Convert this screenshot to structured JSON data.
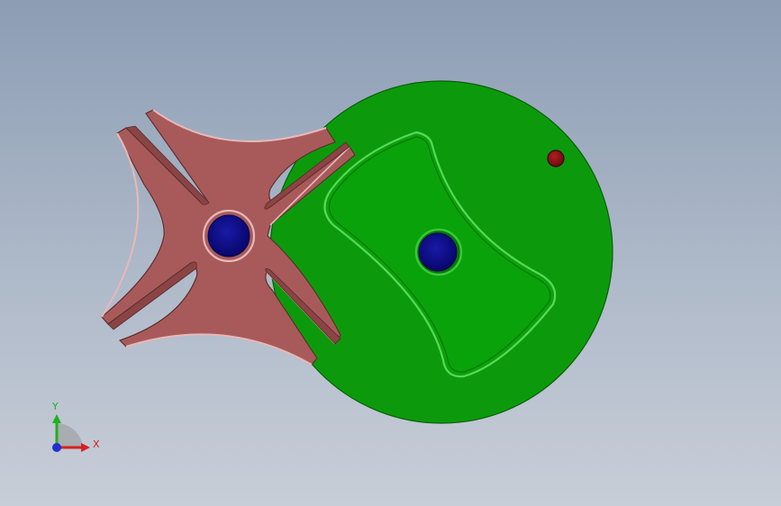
{
  "viewport": {
    "background_top": "#8c9db4",
    "background_bottom": "#c8ced8"
  },
  "model": {
    "parts": [
      {
        "name": "geneva-wheel",
        "color": "#a85a5a"
      },
      {
        "name": "drive-disc",
        "color": "#0c9a0c"
      },
      {
        "name": "shaft-hole",
        "color": "#0a0a88"
      },
      {
        "name": "drive-pin",
        "color": "#8a0e14"
      }
    ]
  },
  "triad": {
    "x_label": "X",
    "y_label": "Y",
    "x_color": "#d42020",
    "y_color": "#20b020",
    "z_color": "#2030d0"
  }
}
